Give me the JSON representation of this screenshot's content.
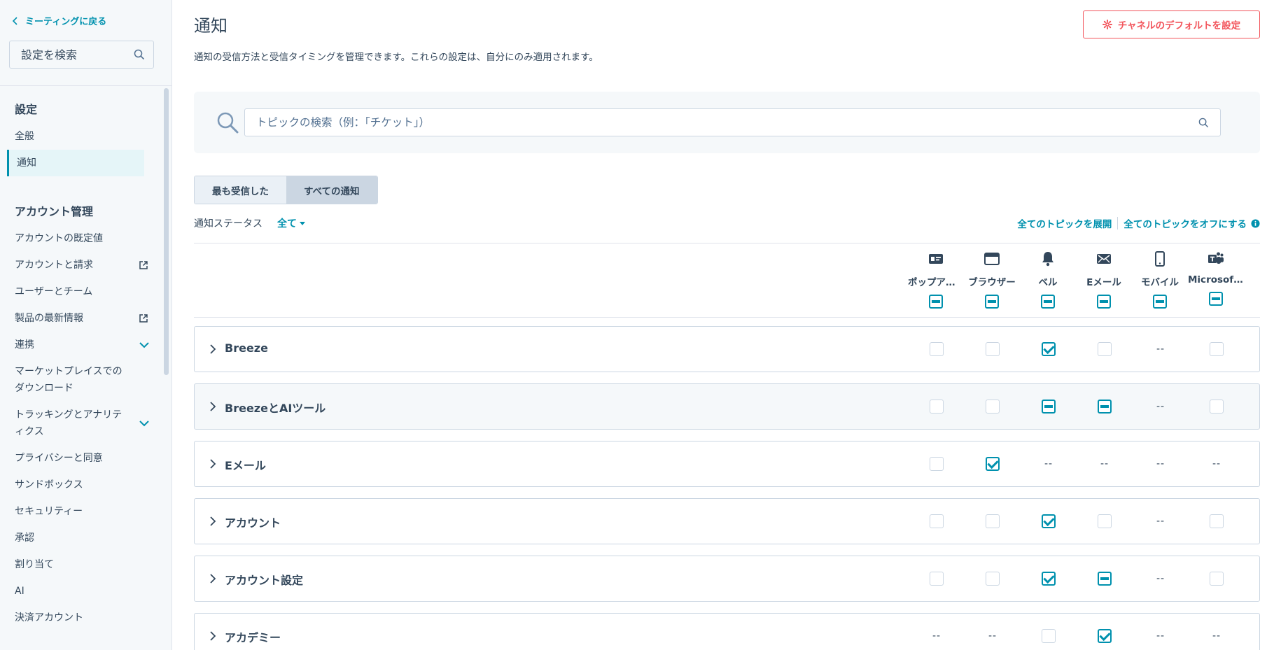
{
  "sidebar": {
    "back_label": "ミーティングに戻る",
    "search_placeholder": "設定を検索",
    "section1_title": "設定",
    "section1_items": [
      {
        "label": "全般"
      },
      {
        "label": "通知"
      }
    ],
    "section2_title": "アカウント管理",
    "section2_items": [
      {
        "label": "アカウントの既定値"
      },
      {
        "label": "アカウントと請求"
      },
      {
        "label": "ユーザーとチーム"
      },
      {
        "label": "製品の最新情報"
      },
      {
        "label": "連携"
      },
      {
        "label": "マーケットプレイスでのダウンロード"
      },
      {
        "label": "トラッキングとアナリティクス"
      },
      {
        "label": "プライバシーと同意"
      },
      {
        "label": "サンドボックス"
      },
      {
        "label": "セキュリティー"
      },
      {
        "label": "承認"
      },
      {
        "label": "割り当て"
      },
      {
        "label": "AI"
      },
      {
        "label": "決済アカウント"
      }
    ]
  },
  "header": {
    "title": "通知",
    "description": "通知の受信方法と受信タイミングを管理できます。これらの設定は、自分にのみ適用されます。",
    "channel_button": "チャネルのデフォルトを設定"
  },
  "topic_search": {
    "placeholder": "トピックの検索（例：「チケット」）"
  },
  "tabs": [
    {
      "label": "最も受信した"
    },
    {
      "label": "すべての通知"
    }
  ],
  "status_filter": {
    "label": "通知ステータス",
    "value": "全て"
  },
  "actions": {
    "expand_all": "全てのトピックを展開",
    "turn_off_all": "全てのトピックをオフにする"
  },
  "columns": [
    {
      "label": "ポップアッ…",
      "icon": "popup-icon",
      "header_state": "partial"
    },
    {
      "label": "ブラウザー",
      "icon": "browser-icon",
      "header_state": "partial"
    },
    {
      "label": "ベル",
      "icon": "bell-icon",
      "header_state": "partial"
    },
    {
      "label": "Eメール",
      "icon": "email-icon",
      "header_state": "partial"
    },
    {
      "label": "モバイル",
      "icon": "mobile-icon",
      "header_state": "partial"
    },
    {
      "label": "Microsoft …",
      "icon": "teams-icon",
      "header_state": "partial"
    }
  ],
  "topics": [
    {
      "name": "Breeze",
      "highlight": false,
      "cells": [
        "off",
        "off",
        "checked",
        "off",
        "na",
        "off"
      ]
    },
    {
      "name": "BreezeとAIツール",
      "highlight": true,
      "cells": [
        "off",
        "off",
        "partial",
        "partial",
        "na",
        "off"
      ]
    },
    {
      "name": "Eメール",
      "highlight": false,
      "cells": [
        "off",
        "checked",
        "na",
        "na",
        "na",
        "na"
      ]
    },
    {
      "name": "アカウント",
      "highlight": false,
      "cells": [
        "off",
        "off",
        "checked",
        "off",
        "na",
        "off"
      ]
    },
    {
      "name": "アカウント設定",
      "highlight": false,
      "cells": [
        "off",
        "off",
        "checked",
        "partial",
        "na",
        "off"
      ]
    },
    {
      "name": "アカデミー",
      "highlight": false,
      "cells": [
        "na",
        "na",
        "off",
        "checked",
        "na",
        "na"
      ]
    }
  ],
  "na_text": "--",
  "colors": {
    "accent": "#0091ae",
    "danger": "#f2545b",
    "text": "#33475b",
    "border": "#cbd6e2"
  }
}
